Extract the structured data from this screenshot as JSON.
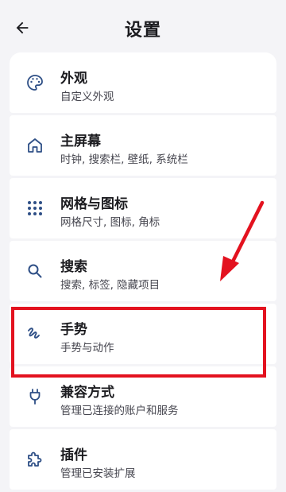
{
  "header": {
    "title": "设置",
    "back_icon": "arrow-left-icon"
  },
  "items": [
    {
      "label": "外观",
      "subtitle": "自定义外观",
      "icon": "palette-icon"
    },
    {
      "label": "主屏幕",
      "subtitle": "时钟, 搜索栏, 壁纸, 系统栏",
      "icon": "home-icon"
    },
    {
      "label": "网格与图标",
      "subtitle": "网格尺寸, 图标, 角标",
      "icon": "grid-icon"
    },
    {
      "label": "搜索",
      "subtitle": "搜索, 标签, 隐藏项目",
      "icon": "search-icon"
    },
    {
      "label": "手势",
      "subtitle": "手势与动作",
      "icon": "gesture-icon"
    },
    {
      "label": "兼容方式",
      "subtitle": "管理已连接的账户和服务",
      "icon": "plug-icon"
    },
    {
      "label": "插件",
      "subtitle": "管理已安装扩展",
      "icon": "puzzle-icon"
    }
  ],
  "colors": {
    "icon": "#2e4f86",
    "annotation": "#e3121f",
    "background": "#f4f4f7",
    "card": "#ffffff"
  }
}
